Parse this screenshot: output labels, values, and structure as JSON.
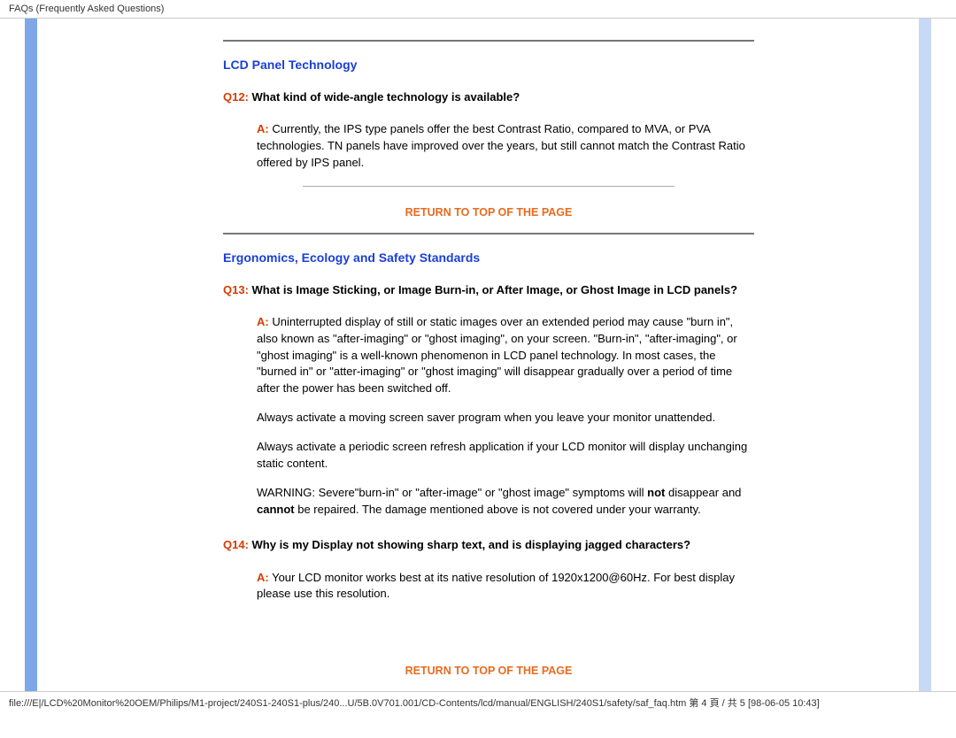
{
  "header_title": "FAQs (Frequently Asked Questions)",
  "section1": {
    "title": "LCD Panel Technology",
    "q12_label": "Q12:",
    "q12_text": " What kind of wide-angle technology is available?",
    "a12_label": "A:",
    "a12_text": " Currently, the IPS type panels offer the best Contrast Ratio, compared to MVA, or PVA technologies.  TN panels have improved over the years, but still cannot match the Contrast Ratio offered by IPS panel.",
    "return": "RETURN TO TOP OF THE PAGE"
  },
  "section2": {
    "title": "Ergonomics, Ecology and Safety Standards",
    "q13_label": "Q13:",
    "q13_text": " What is Image Sticking, or Image Burn-in, or After Image, or Ghost Image in LCD panels?",
    "a13_label": "A:",
    "a13_p1": " Uninterrupted display of still or static images over an extended period may cause \"burn in\", also known as \"after-imaging\" or \"ghost imaging\", on your screen. \"Burn-in\", \"after-imaging\", or \"ghost imaging\" is a well-known phenomenon in LCD panel technology. In most cases, the \"burned in\" or \"atter-imaging\" or \"ghost imaging\" will disappear gradually over a period of time after the power has been switched off.",
    "a13_p2": "Always activate a moving screen saver program when you leave your monitor unattended.",
    "a13_p3": "Always activate a periodic screen refresh application if your LCD monitor will display unchanging static content.",
    "a13_warn_pre": "WARNING: Severe\"burn-in\" or \"after-image\" or \"ghost image\" symptoms will ",
    "a13_warn_not": "not",
    "a13_warn_mid": " disappear and ",
    "a13_warn_cannot": "cannot",
    "a13_warn_post": " be repaired. The damage mentioned above is not covered under your warranty.",
    "q14_label": "Q14:",
    "q14_text": " Why is my Display not showing sharp text, and is displaying jagged characters?",
    "a14_label": "A:",
    "a14_text": " Your LCD monitor works best at its native resolution of 1920x1200@60Hz. For best display please use this resolution.",
    "return": "RETURN TO TOP OF THE PAGE"
  },
  "footer": "file:///E|/LCD%20Monitor%20OEM/Philips/M1-project/240S1-240S1-plus/240...U/5B.0V701.001/CD-Contents/lcd/manual/ENGLISH/240S1/safety/saf_faq.htm 第 4 頁 / 共 5  [98-06-05 10:43]"
}
